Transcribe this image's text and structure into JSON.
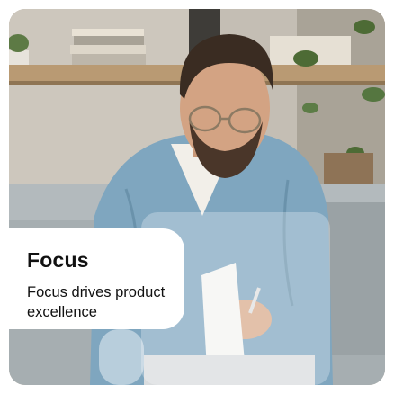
{
  "feature_card": {
    "title": "Focus",
    "description": "Focus drives product excellence",
    "image": "man-with-glasses-reading-paper-photo"
  },
  "colors": {
    "caption_background": "#ffffff",
    "text": "#111111",
    "glass_overlay": "#ffffff"
  }
}
